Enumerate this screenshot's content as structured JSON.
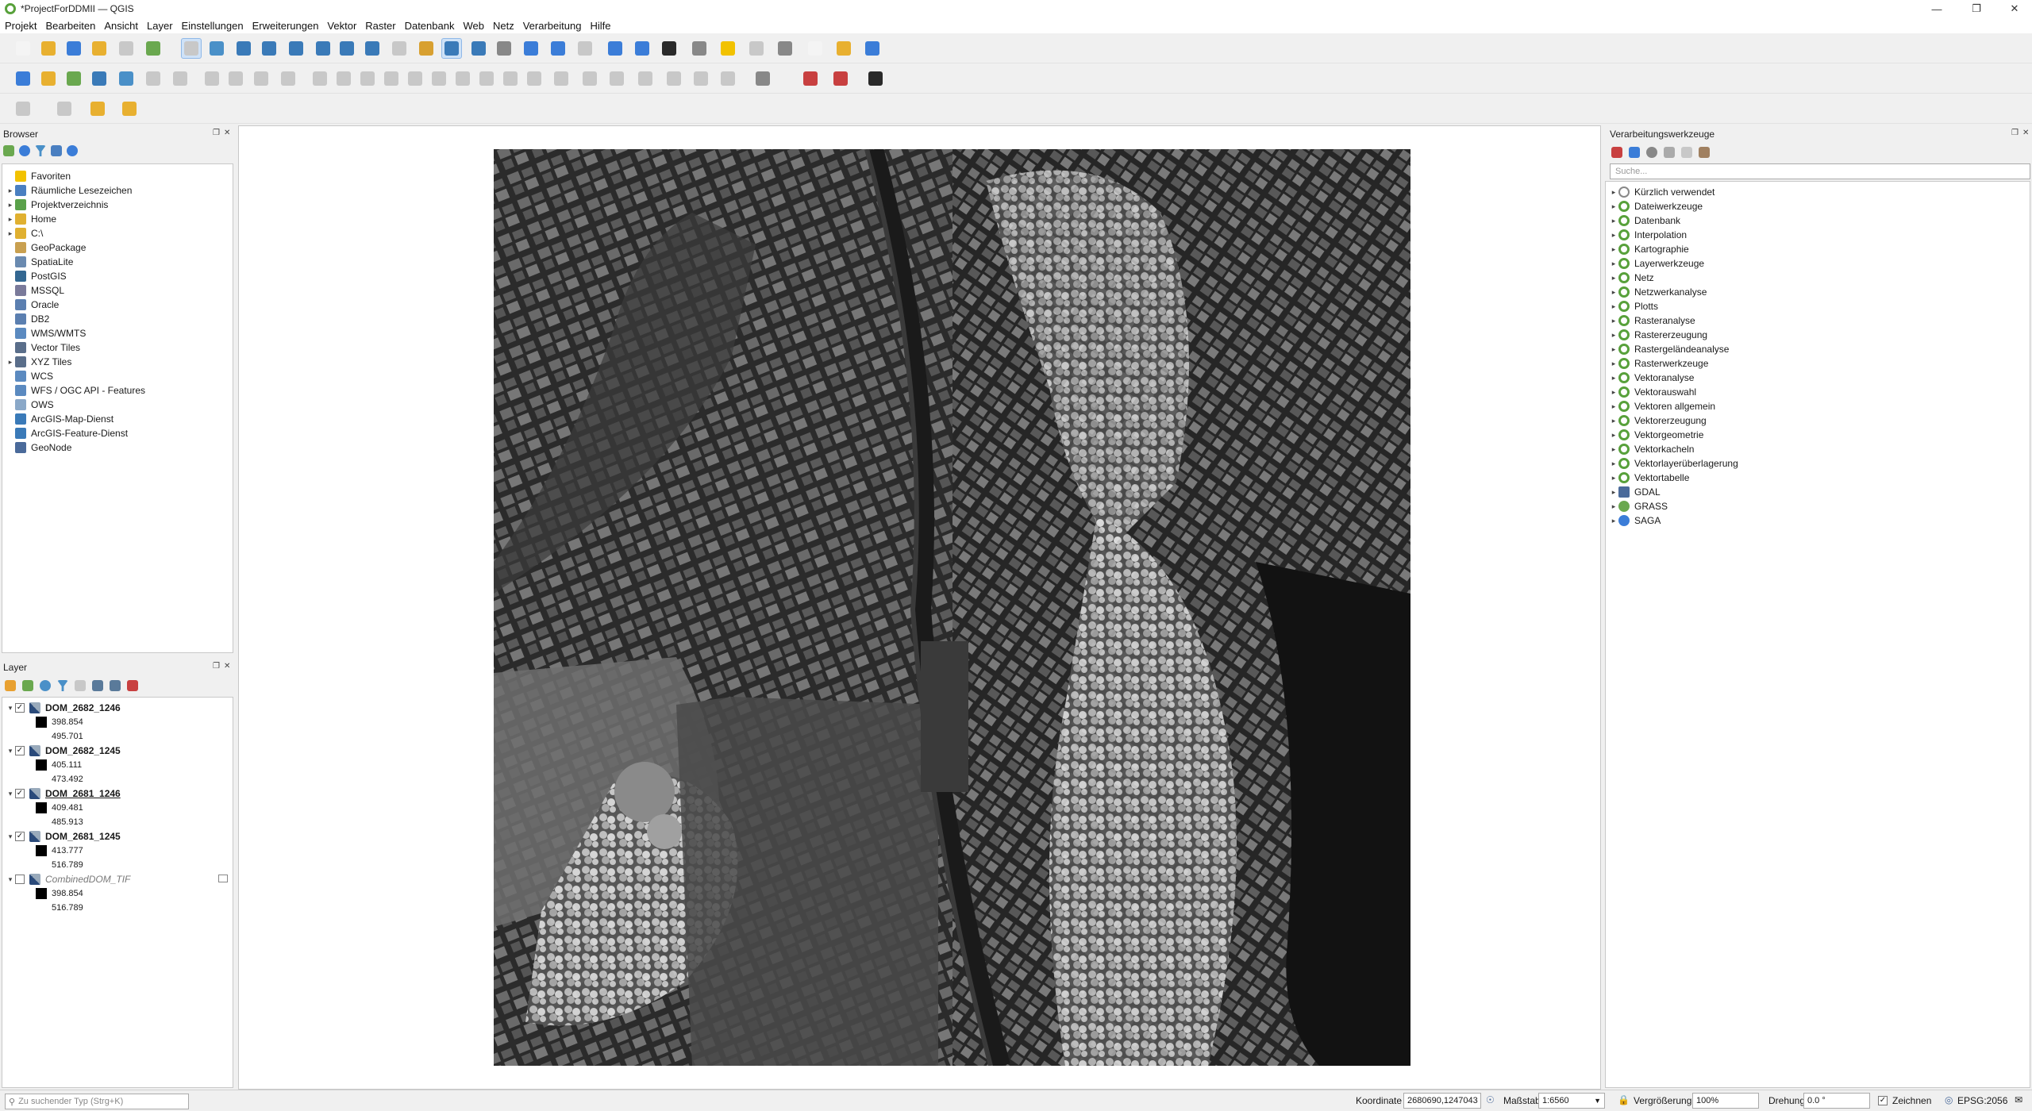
{
  "window": {
    "title": "*ProjectForDDMII — QGIS"
  },
  "menu": [
    "Projekt",
    "Bearbeiten",
    "Ansicht",
    "Layer",
    "Einstellungen",
    "Erweiterungen",
    "Vektor",
    "Raster",
    "Datenbank",
    "Web",
    "Netz",
    "Verarbeitung",
    "Hilfe"
  ],
  "browser": {
    "title": "Browser",
    "items": [
      {
        "label": "Favoriten",
        "icon": "star-icon",
        "color": "#f2c200",
        "expand": false
      },
      {
        "label": "Räumliche Lesezeichen",
        "icon": "bookmark-icon",
        "color": "#4a7fc1",
        "expand": true
      },
      {
        "label": "Projektverzeichnis",
        "icon": "project-folder-icon",
        "color": "#5aa14a",
        "expand": true
      },
      {
        "label": "Home",
        "icon": "home-folder-icon",
        "color": "#e0b030",
        "expand": true
      },
      {
        "label": "C:\\",
        "icon": "drive-icon",
        "color": "#e0b030",
        "expand": true
      },
      {
        "label": "GeoPackage",
        "icon": "geopackage-icon",
        "color": "#c9a050",
        "expand": false
      },
      {
        "label": "SpatiaLite",
        "icon": "spatialite-icon",
        "color": "#6a8ab0",
        "expand": false
      },
      {
        "label": "PostGIS",
        "icon": "postgis-icon",
        "color": "#336791",
        "expand": false
      },
      {
        "label": "MSSQL",
        "icon": "mssql-icon",
        "color": "#7a7a9a",
        "expand": false
      },
      {
        "label": "Oracle",
        "icon": "oracle-icon",
        "color": "#5b7fb0",
        "expand": false
      },
      {
        "label": "DB2",
        "icon": "db2-icon",
        "color": "#5b7fb0",
        "expand": false
      },
      {
        "label": "WMS/WMTS",
        "icon": "wms-icon",
        "color": "#5b8ac0",
        "expand": false
      },
      {
        "label": "Vector Tiles",
        "icon": "vector-tiles-icon",
        "color": "#5a6e8a",
        "expand": false
      },
      {
        "label": "XYZ Tiles",
        "icon": "xyz-tiles-icon",
        "color": "#5a6e8a",
        "expand": true
      },
      {
        "label": "WCS",
        "icon": "wcs-icon",
        "color": "#5b8ac0",
        "expand": false
      },
      {
        "label": "WFS / OGC API - Features",
        "icon": "wfs-icon",
        "color": "#5b8ac0",
        "expand": false
      },
      {
        "label": "OWS",
        "icon": "ows-icon",
        "color": "#8aa8c8",
        "expand": false
      },
      {
        "label": "ArcGIS-Map-Dienst",
        "icon": "arcgis-map-icon",
        "color": "#3a7ab8",
        "expand": false
      },
      {
        "label": "ArcGIS-Feature-Dienst",
        "icon": "arcgis-feature-icon",
        "color": "#3a7ab8",
        "expand": false
      },
      {
        "label": "GeoNode",
        "icon": "geonode-icon",
        "color": "#4a6a9a",
        "expand": false
      }
    ]
  },
  "layers": {
    "title": "Layer",
    "items": [
      {
        "name": "DOM_2682_1246",
        "checked": true,
        "underline": false,
        "italic": false,
        "min": "398.854",
        "max": "495.701"
      },
      {
        "name": "DOM_2682_1245",
        "checked": true,
        "underline": false,
        "italic": false,
        "min": "405.111",
        "max": "473.492"
      },
      {
        "name": "DOM_2681_1246",
        "checked": true,
        "underline": true,
        "italic": false,
        "min": "409.481",
        "max": "485.913"
      },
      {
        "name": "DOM_2681_1245",
        "checked": true,
        "underline": false,
        "italic": false,
        "min": "413.777",
        "max": "516.789"
      },
      {
        "name": "CombinedDOM_TIF",
        "checked": false,
        "underline": false,
        "italic": true,
        "min": "398.854",
        "max": "516.789"
      }
    ]
  },
  "processing": {
    "title": "Verarbeitungswerkzeuge",
    "search_placeholder": "Suche...",
    "items": [
      {
        "label": "Kürzlich verwendet",
        "icon": "clock-icon"
      },
      {
        "label": "Dateiwerkzeuge",
        "icon": "qgis-icon"
      },
      {
        "label": "Datenbank",
        "icon": "qgis-icon"
      },
      {
        "label": "Interpolation",
        "icon": "qgis-icon"
      },
      {
        "label": "Kartographie",
        "icon": "qgis-icon"
      },
      {
        "label": "Layerwerkzeuge",
        "icon": "qgis-icon"
      },
      {
        "label": "Netz",
        "icon": "qgis-icon"
      },
      {
        "label": "Netzwerkanalyse",
        "icon": "qgis-icon"
      },
      {
        "label": "Plotts",
        "icon": "qgis-icon"
      },
      {
        "label": "Rasteranalyse",
        "icon": "qgis-icon"
      },
      {
        "label": "Rastererzeugung",
        "icon": "qgis-icon"
      },
      {
        "label": "Rastergeländeanalyse",
        "icon": "qgis-icon"
      },
      {
        "label": "Rasterwerkzeuge",
        "icon": "qgis-icon"
      },
      {
        "label": "Vektoranalyse",
        "icon": "qgis-icon"
      },
      {
        "label": "Vektorauswahl",
        "icon": "qgis-icon"
      },
      {
        "label": "Vektoren allgemein",
        "icon": "qgis-icon"
      },
      {
        "label": "Vektorerzeugung",
        "icon": "qgis-icon"
      },
      {
        "label": "Vektorgeometrie",
        "icon": "qgis-icon"
      },
      {
        "label": "Vektorkacheln",
        "icon": "qgis-icon"
      },
      {
        "label": "Vektorlayerüberlagerung",
        "icon": "qgis-icon"
      },
      {
        "label": "Vektortabelle",
        "icon": "qgis-icon"
      },
      {
        "label": "GDAL",
        "icon": "gdal-icon"
      },
      {
        "label": "GRASS",
        "icon": "grass-icon"
      },
      {
        "label": "SAGA",
        "icon": "saga-icon"
      }
    ]
  },
  "status": {
    "locator_placeholder": "Zu suchender Typ (Strg+K)",
    "coord_label": "Koordinate",
    "coord_value": "2680690,1247043",
    "scale_label": "Maßstab",
    "scale_value": "1:6560",
    "magnifier_label": "Vergrößerung",
    "magnifier_value": "100%",
    "rotation_label": "Drehung",
    "rotation_value": "0.0 °",
    "render_label": "Zeichnen",
    "crs": "EPSG:2056"
  }
}
